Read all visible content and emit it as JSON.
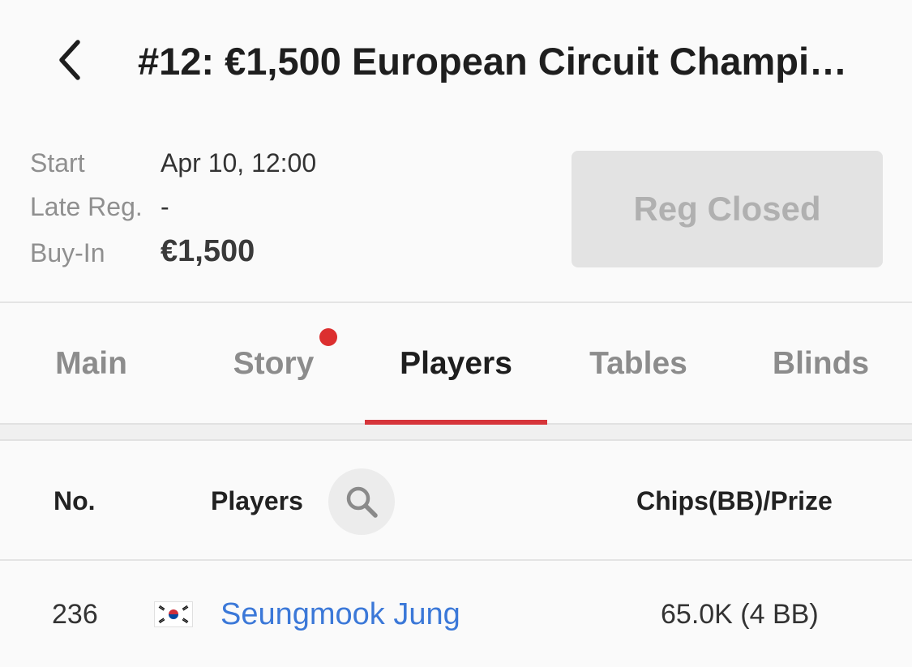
{
  "header": {
    "title": "#12: €1,500 European Circuit Champi…",
    "back_icon": "chevron-left-icon"
  },
  "info": {
    "start_label": "Start",
    "start_value": "Apr 10, 12:00",
    "late_reg_label": "Late Reg.",
    "late_reg_value": "-",
    "buyin_label": "Buy-In",
    "buyin_value": "€1,500",
    "reg_button_label": "Reg Closed"
  },
  "tabs": [
    {
      "label": "Main",
      "active": false
    },
    {
      "label": "Story",
      "active": false,
      "has_notification": true
    },
    {
      "label": "Players",
      "active": true
    },
    {
      "label": "Tables",
      "active": false
    },
    {
      "label": "Blinds",
      "active": false
    }
  ],
  "table": {
    "columns": {
      "no": "No.",
      "players": "Players",
      "chips": "Chips(BB)/Prize"
    },
    "search_icon": "search-icon",
    "rows": [
      {
        "no": "236",
        "flag": "south-korea-flag-icon",
        "name": "Seungmook Jung",
        "chips": "65.0K (4 BB)"
      }
    ]
  },
  "colors": {
    "accent": "#d6353a",
    "notification": "#dc2f2f",
    "link": "#3b78d8",
    "disabled_button_bg": "#e3e3e3",
    "disabled_button_text": "#b0b0b0"
  }
}
